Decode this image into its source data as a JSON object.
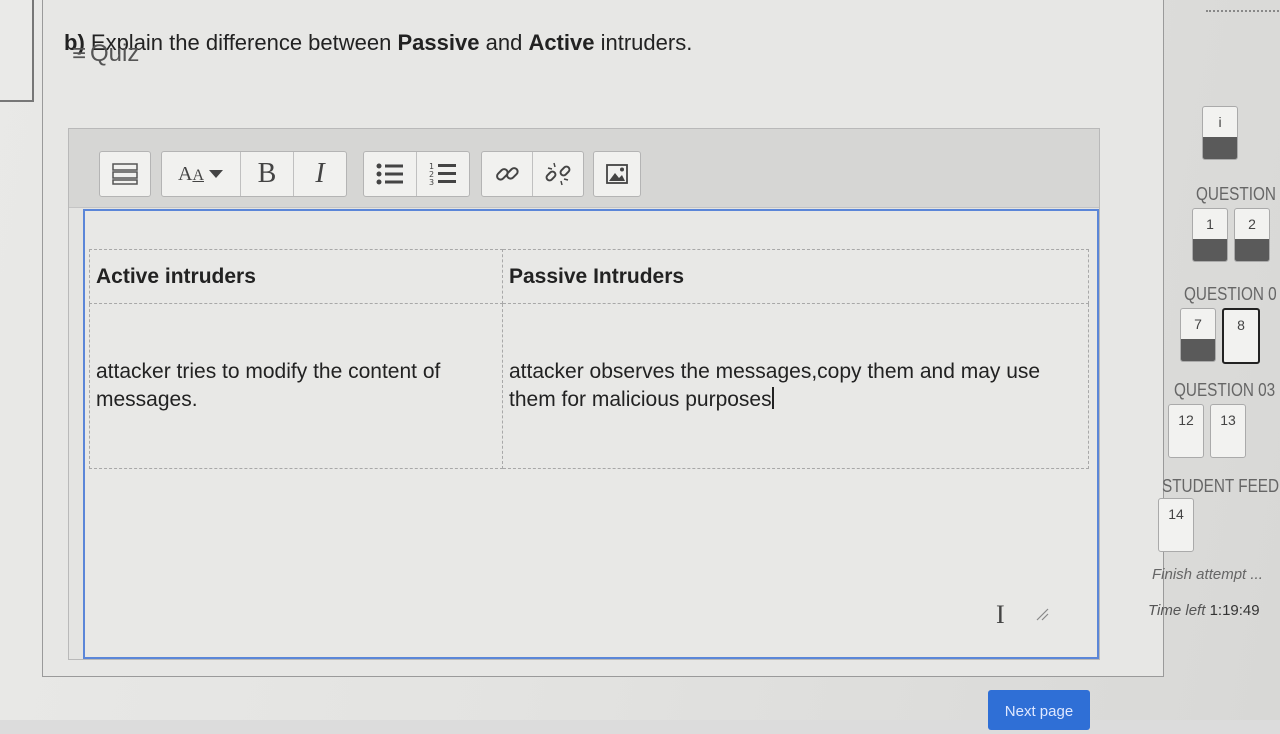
{
  "question": {
    "number": "b)",
    "text_start": "Explain the difference between",
    "term1": "Passive",
    "connector": "and",
    "term2": "Active",
    "text_end": "intruders."
  },
  "editor": {
    "toolbar": {
      "icons": [
        "show-more-icon",
        "font-size-icon",
        "bold",
        "italic",
        "bulleted-list-icon",
        "numbered-list-icon",
        "link-icon",
        "unlink-icon",
        "image-icon"
      ],
      "bold_label": "B",
      "italic_label": "I",
      "font_label": "A"
    },
    "table": {
      "headers": [
        "Active intruders",
        "Passive Intruders"
      ],
      "rows": [
        [
          "attacker tries to modify the content of messages.",
          "attacker observes the messages,copy them and may use them for malicious purposes"
        ]
      ]
    }
  },
  "sidebar": {
    "title": "Quiz",
    "sections": [
      {
        "label": "",
        "questions": [
          "i"
        ]
      },
      {
        "label": "QUESTION",
        "questions": [
          "1",
          "2"
        ]
      },
      {
        "label": "QUESTION 0",
        "questions": [
          "7",
          "8"
        ]
      },
      {
        "label": "QUESTION 03",
        "questions": [
          "12",
          "13"
        ]
      },
      {
        "label": "STUDENT FEED",
        "questions": [
          "14"
        ]
      }
    ],
    "finish_link": "Finish attempt ...",
    "time_label": "Time left",
    "time_value": "1:19:49"
  },
  "next_button": "Next page"
}
